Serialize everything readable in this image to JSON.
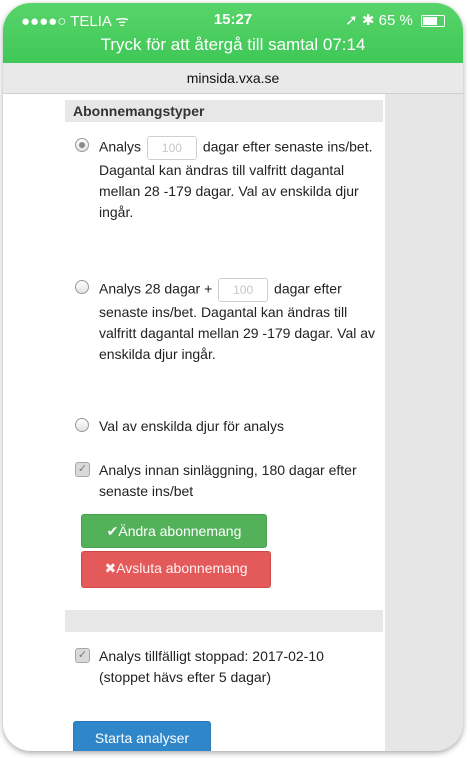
{
  "status_bar": {
    "carrier": "●●●●○ TELIA ᯤ",
    "time": "15:27",
    "battery": "➚ ✱ 65 %",
    "call_banner": "Tryck för att återgå till samtal 07:14"
  },
  "url": "minsida.vxa.se",
  "section": {
    "title": "Abonnemangstyper"
  },
  "options": [
    {
      "pre": "Analys",
      "input_value": "100",
      "post": "dagar efter senaste ins/bet. Dagantal kan ändras till valfritt dagantal mellan 28 -179 dagar. Val av enskilda djur ingår.",
      "checked": true
    },
    {
      "pre": "Analys 28 dagar +",
      "input_value": "100",
      "post": "dagar efter senaste ins/bet. Dagantal kan ändras till valfritt dagantal mellan 29 -179 dagar. Val av enskilda djur ingår.",
      "checked": false
    },
    {
      "label": "Val av enskilda djur för analys",
      "checked": false
    }
  ],
  "checkbox_sinlaggning": {
    "label": "Analys innan sinläggning, 180 dagar efter senaste ins/bet",
    "checked": true
  },
  "buttons": {
    "change": "✔Ändra abonnemang",
    "cancel": "✖Avsluta abonnemang",
    "start": "Starta analyser"
  },
  "paused_notice": {
    "label": "Analys tillfälligt stoppad: 2017-02-10 (stoppet hävs efter 5 dagar)",
    "checked": true
  },
  "colors": {
    "status_green": "#4cd964",
    "button_green": "#53b15a",
    "button_red": "#e45a5a",
    "button_blue": "#2f86c8"
  }
}
